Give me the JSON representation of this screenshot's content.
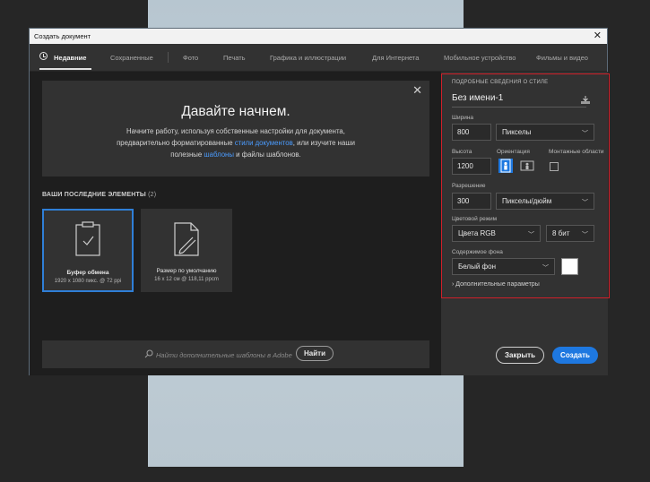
{
  "window": {
    "title": "Создать документ",
    "close_glyph": "✕"
  },
  "tabs": [
    {
      "label": "Недавние",
      "active": true
    },
    {
      "label": "Сохраненные"
    },
    {
      "label": "Фото"
    },
    {
      "label": "Печать"
    },
    {
      "label": "Графика и иллюстрации"
    },
    {
      "label": "Для Интернета"
    },
    {
      "label": "Мобильное устройство"
    },
    {
      "label": "Фильмы и видео"
    }
  ],
  "welcome": {
    "title": "Давайте начнем.",
    "text_1": "Начните работу, используя собственные настройки для документа,",
    "text_2": "предварительно форматированные ",
    "link_1": "стили документов",
    "text_3": ", или изучите наши",
    "text_4": "полезные ",
    "link_2": "шаблоны",
    "text_5": " и файлы шаблонов.",
    "close_glyph": "✕"
  },
  "recent": {
    "heading": "ВАШИ ПОСЛЕДНИЕ ЭЛЕМЕНТЫ",
    "count": "(2)",
    "items": [
      {
        "name": "Буфер обмена",
        "dims": "1920 x 1080 пикс. @ 72 ppi",
        "icon": "clipboard-icon"
      },
      {
        "name": "Размер по умолчанию",
        "dims": "16 x 12 см @ 118,11 ppcm",
        "icon": "document-pen-icon"
      }
    ]
  },
  "search": {
    "placeholder": "Найти дополнительные шаблоны в Adobe",
    "button": "Найти"
  },
  "preset": {
    "heading": "ПОДРОБНЫЕ СВЕДЕНИЯ О СТИЛЕ",
    "doc_name": "Без имени-1",
    "width_label": "Ширина",
    "width_value": "800",
    "width_unit": "Пикселы",
    "height_label": "Высота",
    "height_value": "1200",
    "orientation_label": "Ориентация",
    "artboards_label": "Монтажные области",
    "resolution_label": "Разрешение",
    "resolution_value": "300",
    "resolution_unit": "Пикселы/дюйм",
    "color_mode_label": "Цветовой режим",
    "color_mode": "Цвета RGB",
    "bit_depth": "8 бит",
    "bg_label": "Содержимое фона",
    "bg_value": "Белый фон",
    "bg_color": "#ffffff",
    "advanced": "Дополнительные параметры"
  },
  "buttons": {
    "close": "Закрыть",
    "create": "Создать"
  },
  "colors": {
    "accent": "#1e78e0",
    "highlight_frame": "#d0202a"
  }
}
